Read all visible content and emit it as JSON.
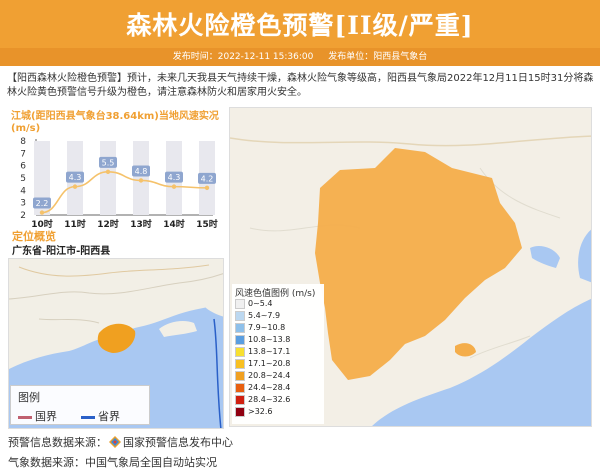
{
  "header": {
    "title": "森林火险橙色预警[II级/严重]",
    "publish_time_label": "发布时间：2022-12-11 15:36:00",
    "publisher_label": "发布单位：阳西县气象台",
    "bg_color": "#f0a033"
  },
  "intro": {
    "text": "【阳西森林火险橙色预警】预计，未来几天我县天气持续干燥，森林火险气象等级高，阳西县气象局2022年12月11日15时31分将森林火险黄色预警信号升级为橙色，请注意森林防火和居家用火安全。"
  },
  "wind_chart": {
    "title": "江城(距阳西县气象台38.64km)当地风速实况(m/s)"
  },
  "chart_data": {
    "type": "line",
    "title": "江城(距阳西县气象台38.64km)当地风速实况(m/s)",
    "categories": [
      "10时",
      "11时",
      "12时",
      "13时",
      "14时",
      "15时"
    ],
    "values": [
      2.2,
      4.3,
      5.5,
      4.8,
      4.3,
      4.2
    ],
    "y_ticks": [
      "2",
      "3",
      "4",
      "5",
      "6",
      "7",
      "8"
    ],
    "ylim": [
      2,
      8
    ],
    "grid": false,
    "color": "#f5c26b",
    "label_box_color": "#8fa6cf"
  },
  "location": {
    "title": "定位概览",
    "name": "广东省-阳江市-阳西县"
  },
  "mini_map": {
    "legend_title": "图例",
    "legend_items": [
      {
        "label": "国界",
        "color": "#c06070"
      },
      {
        "label": "省界",
        "color": "#2a60c8"
      }
    ]
  },
  "speed_legend": {
    "title": "风速色值图例 (m/s)",
    "items": [
      {
        "label": "0~5.4",
        "color": "#f0f0f0"
      },
      {
        "label": "5.4~7.9",
        "color": "#bcd8f0"
      },
      {
        "label": "7.9~10.8",
        "color": "#8ec0ea"
      },
      {
        "label": "10.8~13.8",
        "color": "#5a9ee0"
      },
      {
        "label": "13.8~17.1",
        "color": "#f8e030"
      },
      {
        "label": "17.1~20.8",
        "color": "#f8c020"
      },
      {
        "label": "20.8~24.4",
        "color": "#f0a020"
      },
      {
        "label": "24.4~28.4",
        "color": "#e86010"
      },
      {
        "label": "28.4~32.6",
        "color": "#d02010"
      },
      {
        "label": ">32.6",
        "color": "#900010"
      }
    ]
  },
  "map_labels": {
    "place_1": "阳西县气象台"
  },
  "footer": {
    "warning_source_label": "预警信息数据来源：",
    "warning_source": "国家预警信息发布中心",
    "weather_source_label": "气象数据来源：",
    "weather_source": "中国气象局全国自动站实况"
  }
}
